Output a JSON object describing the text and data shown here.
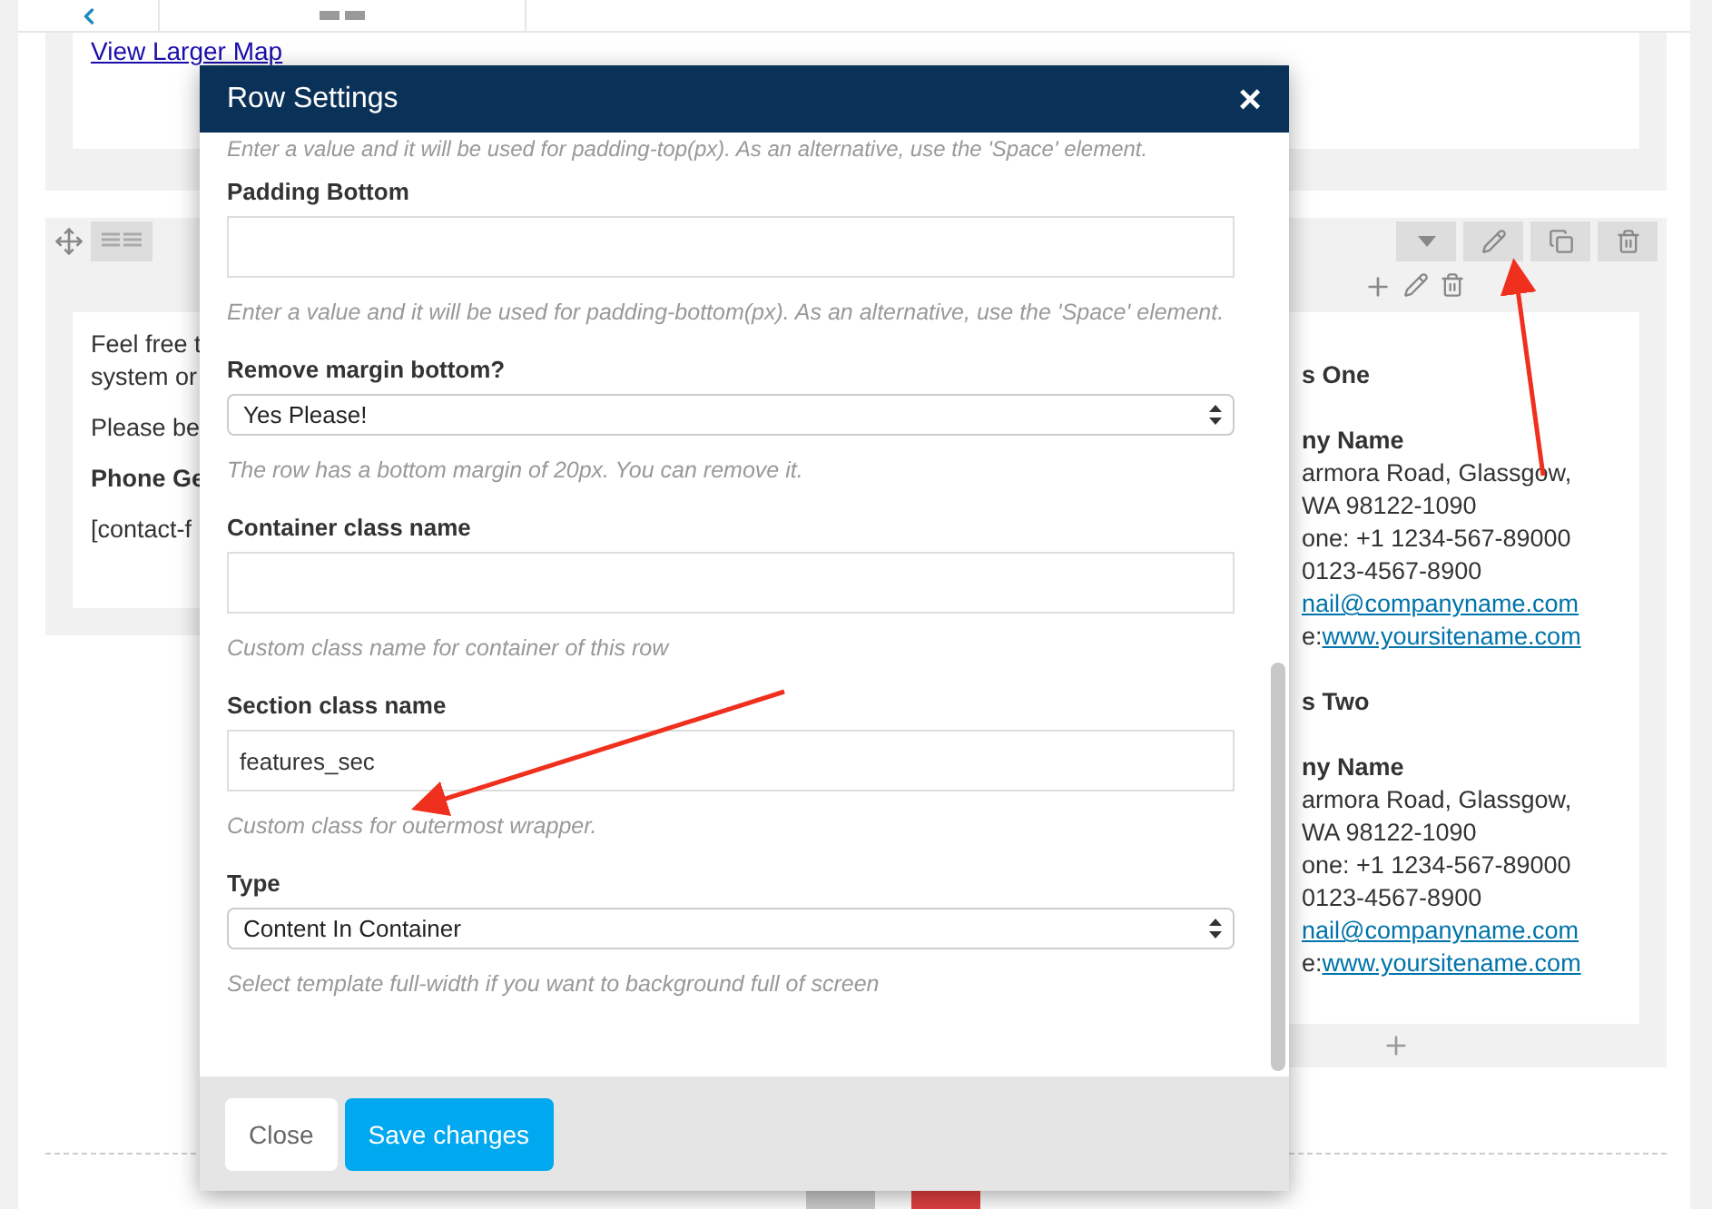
{
  "map_card": {
    "link": "View Larger Map"
  },
  "left_column": {
    "paragraphs": [
      {
        "kind": "text",
        "lines": [
          "Feel free t",
          "system or"
        ]
      },
      {
        "kind": "text",
        "lines": [
          "Please be"
        ]
      },
      {
        "kind": "bold",
        "lines": [
          "Phone Ge"
        ]
      },
      {
        "kind": "text",
        "lines": [
          "[contact-f"
        ]
      }
    ]
  },
  "right_column": {
    "blocks": [
      {
        "heading": "s One",
        "company": "ny Name",
        "lines": [
          "armora Road, Glassgow,",
          "WA 98122-1090",
          "one: +1 1234-567-89000",
          "0123-4567-8900"
        ],
        "email": "nail@companyname.com",
        "site_prefix": "e:",
        "site": "www.yoursitename.com"
      },
      {
        "heading": "s Two",
        "company": "ny Name",
        "lines": [
          "armora Road, Glassgow,",
          "WA 98122-1090",
          "one: +1 1234-567-89000",
          "0123-4567-8900"
        ],
        "email": "nail@companyname.com",
        "site_prefix": "e:",
        "site": "www.yoursitename.com"
      }
    ]
  },
  "modal": {
    "title": "Row Settings",
    "close": "×",
    "top_help": "Enter a value and it will be used for padding-top(px). As an alternative, use the 'Space' element.",
    "fields": [
      {
        "kind": "input",
        "label": "Padding Bottom",
        "help": "Enter a value and it will be used for padding-bottom(px). As an alternative, use the 'Space' element."
      },
      {
        "kind": "select",
        "label": "Remove margin bottom?",
        "value": "Yes Please!",
        "help": "The row has a bottom margin of 20px. You can remove it."
      },
      {
        "kind": "input",
        "label": "Container class name",
        "help": "Custom class name for container of this row"
      },
      {
        "kind": "input",
        "label": "Section class name",
        "value": "features_sec",
        "help": "Custom class for outermost wrapper."
      },
      {
        "kind": "select",
        "label": "Type",
        "value": "Content In Container",
        "help": "Select template full-width if you want to background full of screen"
      }
    ],
    "buttons": [
      {
        "label": "Close",
        "kind": "secondary"
      },
      {
        "label": "Save changes",
        "kind": "primary"
      }
    ]
  }
}
